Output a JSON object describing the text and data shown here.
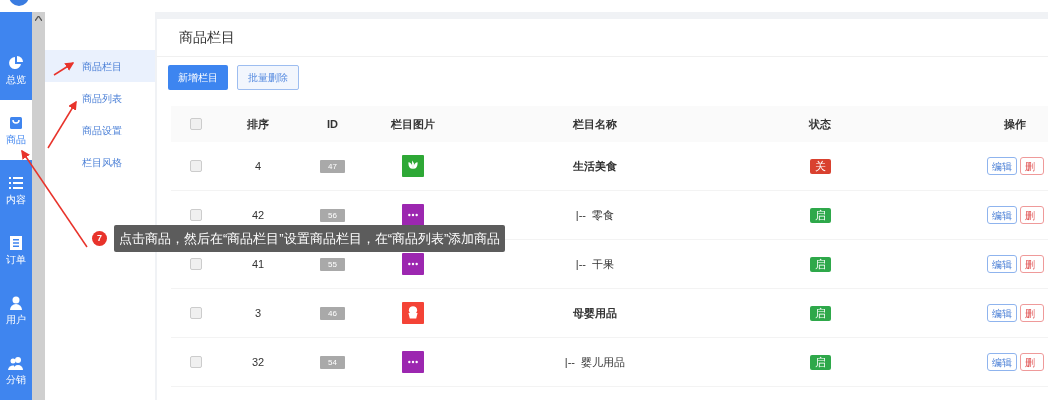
{
  "nav": [
    {
      "label": "总览",
      "kind": "pie",
      "selected": false
    },
    {
      "label": "商品",
      "kind": "bag",
      "selected": true
    },
    {
      "label": "内容",
      "kind": "list",
      "selected": false
    },
    {
      "label": "订单",
      "kind": "doc",
      "selected": false
    },
    {
      "label": "用户",
      "kind": "user",
      "selected": false
    },
    {
      "label": "分销",
      "kind": "users",
      "selected": false
    }
  ],
  "submenu": [
    {
      "label": "商品栏目",
      "selected": true
    },
    {
      "label": "商品列表",
      "selected": false
    },
    {
      "label": "商品设置",
      "selected": false
    },
    {
      "label": "栏目风格",
      "selected": false
    }
  ],
  "page_title": "商品栏目",
  "buttons": [
    {
      "label": "新增栏目",
      "kind": "primary"
    },
    {
      "label": "批量删除",
      "kind": "outline"
    }
  ],
  "table": {
    "select_all_checked": false,
    "columns": [
      "排序",
      "ID",
      "栏目图片",
      "栏目名称",
      "状态",
      "操作"
    ],
    "rows": [
      {
        "checked": false,
        "order": "4",
        "id": "47",
        "image": {
          "kind": "leaf",
          "color": "#2ea836"
        },
        "name": "生活美食",
        "top_level": true,
        "status": {
          "label": "关",
          "on": false
        },
        "actions": [
          "编辑",
          "删"
        ]
      },
      {
        "checked": false,
        "order": "42",
        "id": "56",
        "image": {
          "kind": "dots",
          "color": "#9c27b0"
        },
        "name": "|--  零食",
        "top_level": false,
        "status": {
          "label": "启",
          "on": true
        },
        "actions": [
          "编辑",
          "删"
        ]
      },
      {
        "checked": false,
        "order": "41",
        "id": "55",
        "image": {
          "kind": "dots",
          "color": "#9c27b0"
        },
        "name": "|--  干果",
        "top_level": false,
        "status": {
          "label": "启",
          "on": true
        },
        "actions": [
          "编辑",
          "删"
        ]
      },
      {
        "checked": false,
        "order": "3",
        "id": "46",
        "image": {
          "kind": "cake",
          "color": "#f44336"
        },
        "name": "母婴用品",
        "top_level": true,
        "status": {
          "label": "启",
          "on": true
        },
        "actions": [
          "编辑",
          "删"
        ]
      },
      {
        "checked": false,
        "order": "32",
        "id": "54",
        "image": {
          "kind": "dots",
          "color": "#9c27b0"
        },
        "name": "|--  婴儿用品",
        "top_level": false,
        "status": {
          "label": "启",
          "on": true
        },
        "actions": [
          "编辑",
          "删"
        ]
      }
    ]
  },
  "tip": {
    "step": "7",
    "text": "点击商品，然后在“商品栏目”设置商品栏目，在“商品列表”添加商品"
  }
}
